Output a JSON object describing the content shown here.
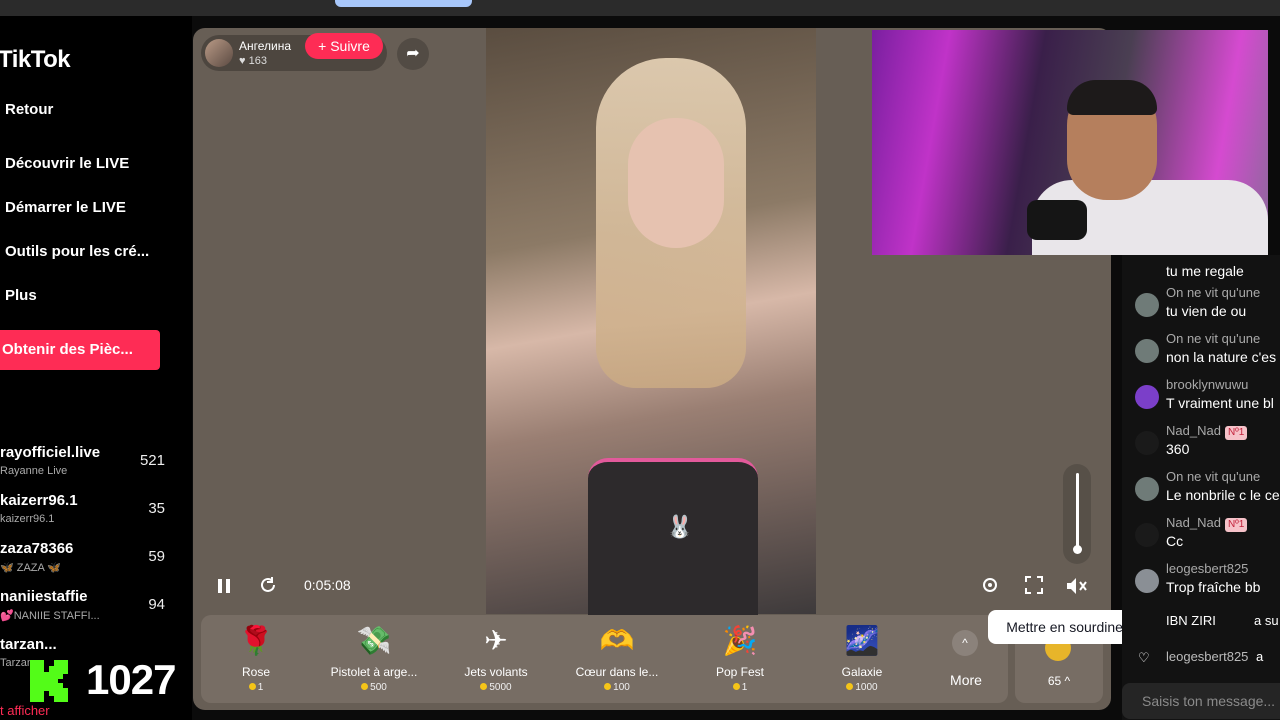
{
  "sidebar": {
    "logo": "TikTok",
    "nav": [
      "Retour",
      "Découvrir le LIVE",
      "Démarrer le LIVE",
      "Outils pour les cré...",
      "Plus"
    ],
    "coins_button": "Obtenir des Pièc...",
    "creators": [
      {
        "name": "rayofficiel.live",
        "sub": "Rayanne Live",
        "count": "521"
      },
      {
        "name": "kaizerr96.1",
        "sub": "kaizerr96.1",
        "count": "35"
      },
      {
        "name": "zaza78366",
        "sub": "🦋 ZAZA 🦋",
        "count": "59"
      },
      {
        "name": "naniiestaffie",
        "sub": "💕NANIIE STAFFI...",
        "count": "94"
      },
      {
        "name": "tarzan...",
        "sub": "Tarzan",
        "count": ""
      }
    ],
    "kick_viewers": "1027",
    "show_link": "t afficher"
  },
  "player": {
    "host_name": "Ангелина",
    "host_likes": "♥ 163",
    "follow_label": "+ Suivre",
    "time": "0:05:08",
    "tooltip": "Mettre en sourdine (M)",
    "volume": 0.05,
    "gifts": [
      {
        "name": "Rose",
        "price": "1",
        "icon": "🌹"
      },
      {
        "name": "Pistolet à arge...",
        "price": "500",
        "icon": "💸"
      },
      {
        "name": "Jets volants",
        "price": "5000",
        "icon": "✈"
      },
      {
        "name": "Cœur dans le...",
        "price": "100",
        "icon": "🫶"
      },
      {
        "name": "Pop Fest",
        "price": "1",
        "icon": "🎉"
      },
      {
        "name": "Galaxie",
        "price": "1000",
        "icon": "🌌"
      }
    ],
    "more_label": "More",
    "balance": "65 ^"
  },
  "chat": {
    "messages": [
      {
        "user": "",
        "text": "tu me regale"
      },
      {
        "user": "On ne vit qu'une",
        "text": "tu vien de ou"
      },
      {
        "user": "On ne vit qu'une",
        "text": "non la nature c'es"
      },
      {
        "user": "brooklynwuwu",
        "text": "T vraiment une bl"
      },
      {
        "user": "Nad_Nad",
        "badge": "Nº1",
        "text": "360"
      },
      {
        "user": "On ne vit qu'une",
        "text": "Le nonbrile c le ce"
      },
      {
        "user": "Nad_Nad",
        "badge": "Nº1",
        "text": "Cc"
      },
      {
        "user": "leogesbert825",
        "text": "Trop fraîche bb"
      },
      {
        "user": "IBN ZIRI",
        "text": "a su"
      },
      {
        "user": "leogesbert825",
        "text": "a"
      }
    ],
    "placeholder": "Saisis ton message..."
  }
}
